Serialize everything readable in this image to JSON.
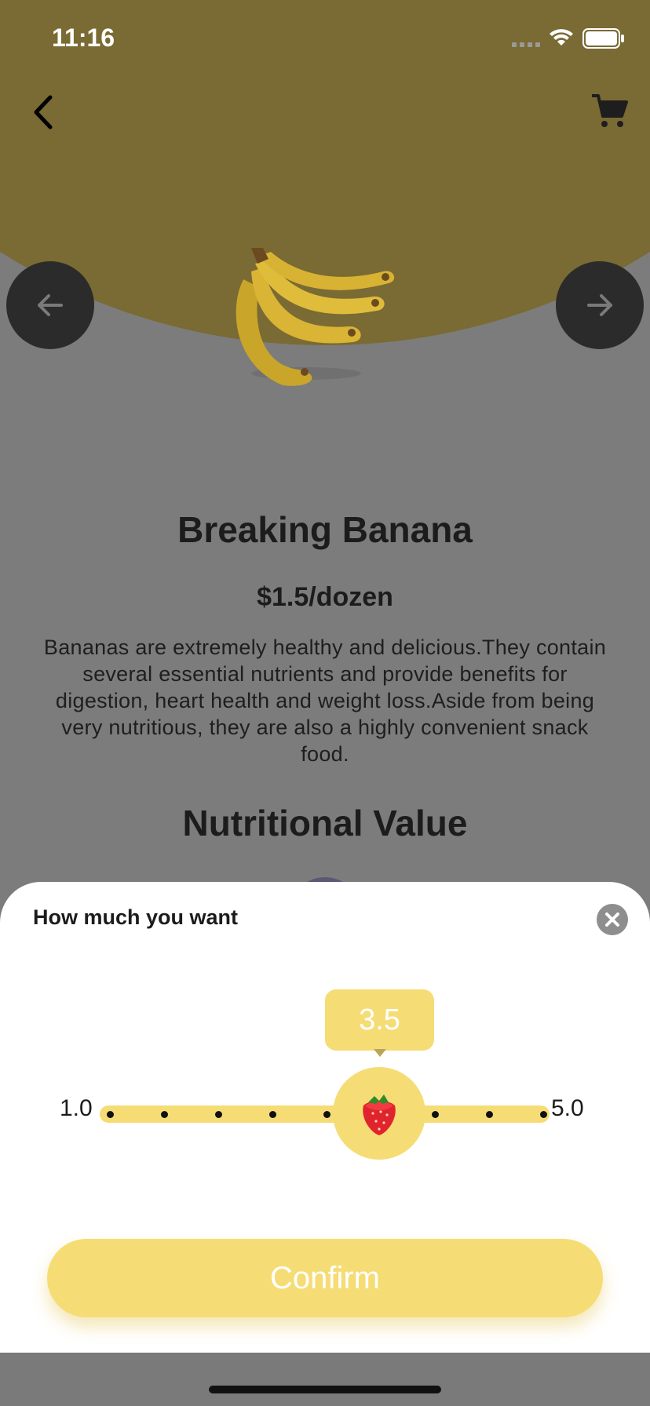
{
  "status_bar": {
    "time": "11:16"
  },
  "header": {
    "back_icon": "chevron-left-icon",
    "cart_icon": "cart-icon"
  },
  "product": {
    "name": "Breaking Banana",
    "price": "$1.5/dozen",
    "description": "Bananas are extremely healthy and delicious.They contain several essential nutrients and provide benefits for digestion, heart health and weight loss.Aside from being very nutritious, they are also a highly convenient snack food.",
    "section_title": "Nutritional Value"
  },
  "sheet": {
    "title": "How much you want",
    "slider": {
      "min_label": "1.0",
      "max_label": "5.0",
      "value": 3.5,
      "value_label": "3.5",
      "min": 1.0,
      "max": 5.0,
      "tick_count": 9
    },
    "confirm_label": "Confirm"
  },
  "colors": {
    "accent": "#f6dc74",
    "hero_dimmed": "#7a6a33",
    "overlay": "#7c7c7c"
  }
}
